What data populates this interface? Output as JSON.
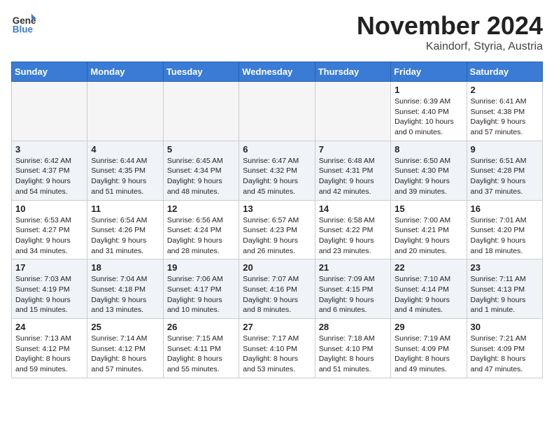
{
  "header": {
    "logo_general": "General",
    "logo_blue": "Blue",
    "month": "November 2024",
    "location": "Kaindorf, Styria, Austria"
  },
  "weekdays": [
    "Sunday",
    "Monday",
    "Tuesday",
    "Wednesday",
    "Thursday",
    "Friday",
    "Saturday"
  ],
  "weeks": [
    [
      {
        "day": "",
        "info": ""
      },
      {
        "day": "",
        "info": ""
      },
      {
        "day": "",
        "info": ""
      },
      {
        "day": "",
        "info": ""
      },
      {
        "day": "",
        "info": ""
      },
      {
        "day": "1",
        "info": "Sunrise: 6:39 AM\nSunset: 4:40 PM\nDaylight: 10 hours\nand 0 minutes."
      },
      {
        "day": "2",
        "info": "Sunrise: 6:41 AM\nSunset: 4:38 PM\nDaylight: 9 hours\nand 57 minutes."
      }
    ],
    [
      {
        "day": "3",
        "info": "Sunrise: 6:42 AM\nSunset: 4:37 PM\nDaylight: 9 hours\nand 54 minutes."
      },
      {
        "day": "4",
        "info": "Sunrise: 6:44 AM\nSunset: 4:35 PM\nDaylight: 9 hours\nand 51 minutes."
      },
      {
        "day": "5",
        "info": "Sunrise: 6:45 AM\nSunset: 4:34 PM\nDaylight: 9 hours\nand 48 minutes."
      },
      {
        "day": "6",
        "info": "Sunrise: 6:47 AM\nSunset: 4:32 PM\nDaylight: 9 hours\nand 45 minutes."
      },
      {
        "day": "7",
        "info": "Sunrise: 6:48 AM\nSunset: 4:31 PM\nDaylight: 9 hours\nand 42 minutes."
      },
      {
        "day": "8",
        "info": "Sunrise: 6:50 AM\nSunset: 4:30 PM\nDaylight: 9 hours\nand 39 minutes."
      },
      {
        "day": "9",
        "info": "Sunrise: 6:51 AM\nSunset: 4:28 PM\nDaylight: 9 hours\nand 37 minutes."
      }
    ],
    [
      {
        "day": "10",
        "info": "Sunrise: 6:53 AM\nSunset: 4:27 PM\nDaylight: 9 hours\nand 34 minutes."
      },
      {
        "day": "11",
        "info": "Sunrise: 6:54 AM\nSunset: 4:26 PM\nDaylight: 9 hours\nand 31 minutes."
      },
      {
        "day": "12",
        "info": "Sunrise: 6:56 AM\nSunset: 4:24 PM\nDaylight: 9 hours\nand 28 minutes."
      },
      {
        "day": "13",
        "info": "Sunrise: 6:57 AM\nSunset: 4:23 PM\nDaylight: 9 hours\nand 26 minutes."
      },
      {
        "day": "14",
        "info": "Sunrise: 6:58 AM\nSunset: 4:22 PM\nDaylight: 9 hours\nand 23 minutes."
      },
      {
        "day": "15",
        "info": "Sunrise: 7:00 AM\nSunset: 4:21 PM\nDaylight: 9 hours\nand 20 minutes."
      },
      {
        "day": "16",
        "info": "Sunrise: 7:01 AM\nSunset: 4:20 PM\nDaylight: 9 hours\nand 18 minutes."
      }
    ],
    [
      {
        "day": "17",
        "info": "Sunrise: 7:03 AM\nSunset: 4:19 PM\nDaylight: 9 hours\nand 15 minutes."
      },
      {
        "day": "18",
        "info": "Sunrise: 7:04 AM\nSunset: 4:18 PM\nDaylight: 9 hours\nand 13 minutes."
      },
      {
        "day": "19",
        "info": "Sunrise: 7:06 AM\nSunset: 4:17 PM\nDaylight: 9 hours\nand 10 minutes."
      },
      {
        "day": "20",
        "info": "Sunrise: 7:07 AM\nSunset: 4:16 PM\nDaylight: 9 hours\nand 8 minutes."
      },
      {
        "day": "21",
        "info": "Sunrise: 7:09 AM\nSunset: 4:15 PM\nDaylight: 9 hours\nand 6 minutes."
      },
      {
        "day": "22",
        "info": "Sunrise: 7:10 AM\nSunset: 4:14 PM\nDaylight: 9 hours\nand 4 minutes."
      },
      {
        "day": "23",
        "info": "Sunrise: 7:11 AM\nSunset: 4:13 PM\nDaylight: 9 hours\nand 1 minute."
      }
    ],
    [
      {
        "day": "24",
        "info": "Sunrise: 7:13 AM\nSunset: 4:12 PM\nDaylight: 8 hours\nand 59 minutes."
      },
      {
        "day": "25",
        "info": "Sunrise: 7:14 AM\nSunset: 4:12 PM\nDaylight: 8 hours\nand 57 minutes."
      },
      {
        "day": "26",
        "info": "Sunrise: 7:15 AM\nSunset: 4:11 PM\nDaylight: 8 hours\nand 55 minutes."
      },
      {
        "day": "27",
        "info": "Sunrise: 7:17 AM\nSunset: 4:10 PM\nDaylight: 8 hours\nand 53 minutes."
      },
      {
        "day": "28",
        "info": "Sunrise: 7:18 AM\nSunset: 4:10 PM\nDaylight: 8 hours\nand 51 minutes."
      },
      {
        "day": "29",
        "info": "Sunrise: 7:19 AM\nSunset: 4:09 PM\nDaylight: 8 hours\nand 49 minutes."
      },
      {
        "day": "30",
        "info": "Sunrise: 7:21 AM\nSunset: 4:09 PM\nDaylight: 8 hours\nand 47 minutes."
      }
    ]
  ]
}
